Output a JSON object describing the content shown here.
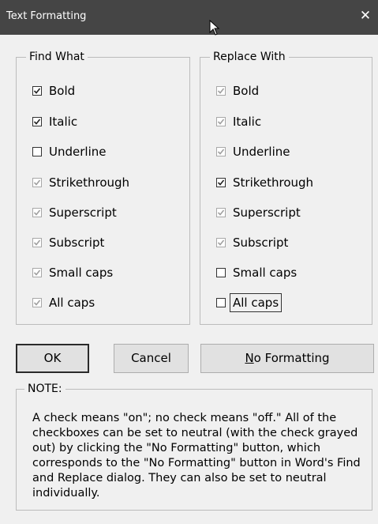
{
  "window": {
    "title": "Text Formatting",
    "close_symbol": "✕"
  },
  "find_what": {
    "legend": "Find What",
    "items": [
      {
        "label": "Bold",
        "state": "checked"
      },
      {
        "label": "Italic",
        "state": "checked"
      },
      {
        "label": "Underline",
        "state": "unchecked"
      },
      {
        "label": "Strikethrough",
        "state": "neutral"
      },
      {
        "label": "Superscript",
        "state": "neutral"
      },
      {
        "label": "Subscript",
        "state": "neutral"
      },
      {
        "label": "Small caps",
        "state": "neutral"
      },
      {
        "label": "All caps",
        "state": "neutral"
      }
    ]
  },
  "replace_with": {
    "legend": "Replace With",
    "items": [
      {
        "label": "Bold",
        "state": "neutral"
      },
      {
        "label": "Italic",
        "state": "neutral"
      },
      {
        "label": "Underline",
        "state": "neutral"
      },
      {
        "label": "Strikethrough",
        "state": "checked"
      },
      {
        "label": "Superscript",
        "state": "neutral"
      },
      {
        "label": "Subscript",
        "state": "neutral"
      },
      {
        "label": "Small caps",
        "state": "unchecked"
      },
      {
        "label": "All caps",
        "state": "unchecked",
        "focused": true
      }
    ]
  },
  "buttons": {
    "ok": "OK",
    "cancel": "Cancel",
    "no_formatting_mnemonic": "N",
    "no_formatting_rest": "o Formatting"
  },
  "note": {
    "legend": "NOTE:",
    "text": "A check means \"on\"; no check means \"off.\" All of the checkboxes can be set to neutral (with the check grayed out) by clicking the \"No Formatting\" button, which corresponds to the \"No Formatting\" button in Word's Find and Replace dialog. They can also be set to neutral individually."
  },
  "colors": {
    "title_bar": "#454545",
    "dialog_bg": "#f0f0f0",
    "check_dark": "#222222",
    "check_neutral": "#a0a0a0"
  }
}
